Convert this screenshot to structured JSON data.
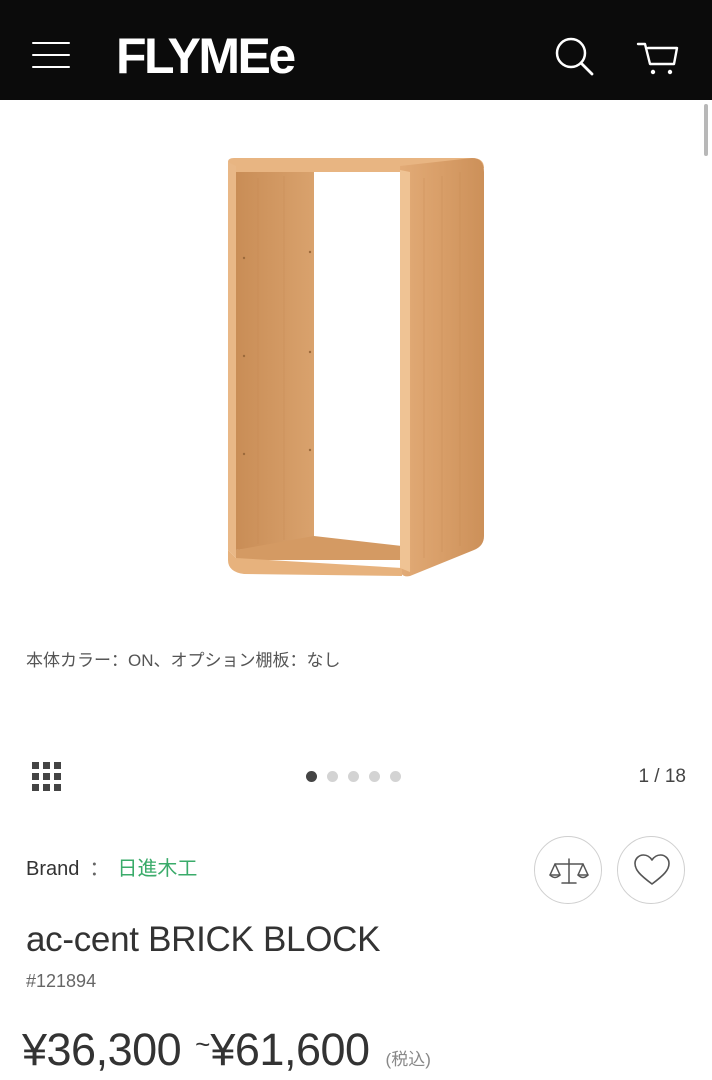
{
  "header": {
    "logo": "FLYMEe",
    "icons": [
      "menu-icon",
      "search-icon",
      "cart-icon"
    ]
  },
  "gallery": {
    "caption": "本体カラー：ON、オプション棚板：なし",
    "counter": "1 / 18",
    "current_index": 1,
    "total": 18,
    "visible_dots": 5,
    "active_dot": 1
  },
  "product": {
    "brand_label": "Brand",
    "brand_separator": "：",
    "brand_name": "日進木工",
    "name": "ac-cent BRICK BLOCK",
    "code": "#121894",
    "price_min": "¥36,300",
    "price_tilde": "~",
    "price_max": "¥61,600",
    "tax_note": "(税込)"
  },
  "colors": {
    "header_bg": "#0b0b0b",
    "brand_link": "#3aab6a",
    "wood": "#d9a06c"
  }
}
